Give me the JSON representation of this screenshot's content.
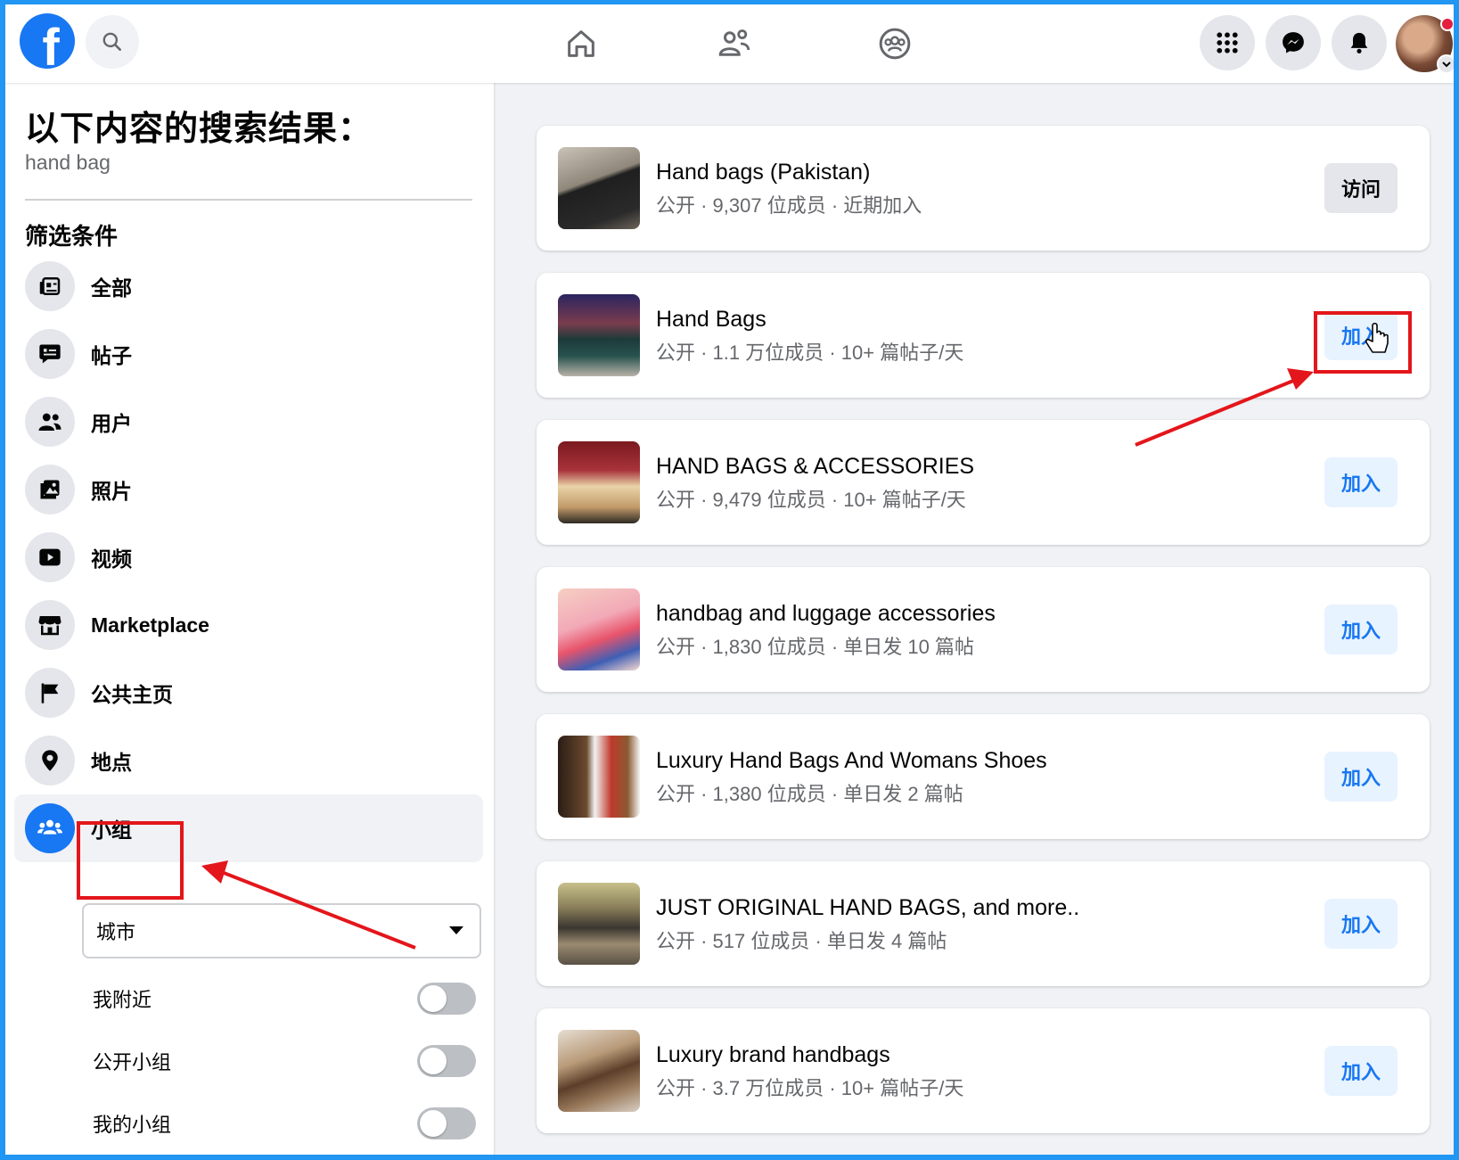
{
  "topbar": {
    "logo_letter": "f",
    "icons": [
      "search-icon",
      "home-icon",
      "friends-icon",
      "groups-icon",
      "menu-grid-icon",
      "messenger-icon",
      "bell-icon"
    ]
  },
  "sidebar": {
    "title": "以下内容的搜索结果：",
    "query": "hand bag",
    "filters_heading": "筛选条件",
    "items": [
      {
        "label": "全部",
        "icon": "all-results-icon"
      },
      {
        "label": "帖子",
        "icon": "posts-icon"
      },
      {
        "label": "用户",
        "icon": "people-icon"
      },
      {
        "label": "照片",
        "icon": "photos-icon"
      },
      {
        "label": "视频",
        "icon": "video-icon"
      },
      {
        "label": "Marketplace",
        "icon": "marketplace-icon"
      },
      {
        "label": "公共主页",
        "icon": "pages-flag-icon"
      },
      {
        "label": "地点",
        "icon": "location-pin-icon"
      },
      {
        "label": "小组",
        "icon": "groups-icon",
        "active": true
      }
    ],
    "city_select": "城市",
    "toggles": [
      {
        "label": "我附近",
        "on": false
      },
      {
        "label": "公开小组",
        "on": false
      },
      {
        "label": "我的小组",
        "on": false
      }
    ]
  },
  "results": [
    {
      "name": "Hand bags (Pakistan)",
      "meta": "公开 · 9,307 位成员 · 近期加入",
      "button": "访问"
    },
    {
      "name": "Hand Bags",
      "meta": "公开 · 1.1 万位成员 · 10+ 篇帖子/天",
      "button": "加入"
    },
    {
      "name": "HAND BAGS & ACCESSORIES",
      "meta": "公开 · 9,479 位成员 · 10+ 篇帖子/天",
      "button": "加入"
    },
    {
      "name": "handbag and luggage accessories",
      "meta": "公开 · 1,830 位成员 · 单日发 10 篇帖",
      "button": "加入"
    },
    {
      "name": "Luxury Hand Bags And Womans Shoes",
      "meta": "公开 · 1,380 位成员 · 单日发 2 篇帖",
      "button": "加入"
    },
    {
      "name": "JUST ORIGINAL HAND BAGS, and more..",
      "meta": "公开 · 517 位成员 · 单日发 4 篇帖",
      "button": "加入"
    },
    {
      "name": "Luxury brand handbags",
      "meta": "公开 · 3.7 万位成员 · 10+ 篇帖子/天",
      "button": "加入"
    }
  ],
  "colors": {
    "accent": "#1877f2",
    "annotation": "#e3161b",
    "frame": "#2196f3"
  }
}
